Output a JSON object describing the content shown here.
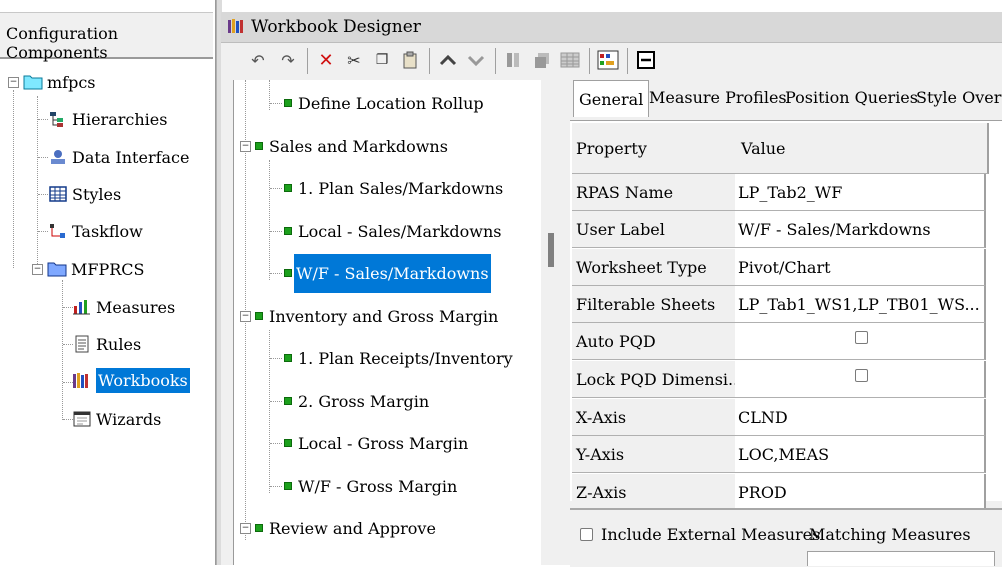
{
  "left_panel": {
    "header": "Configuration Components",
    "tree": {
      "root": "mfpcs",
      "items": [
        "Hierarchies",
        "Data Interface",
        "Styles",
        "Taskflow"
      ],
      "group": "MFPRCS",
      "group_items": [
        "Measures",
        "Rules",
        "Workbooks",
        "Wizards"
      ],
      "selected": "Workbooks"
    }
  },
  "designer": {
    "title": "Workbook Designer",
    "toolbar": {
      "icons": [
        "undo-icon",
        "redo-icon",
        "delete-icon",
        "cut-icon",
        "copy-icon",
        "paste-icon",
        "move-up-icon",
        "move-down-icon",
        "tab-icon",
        "window-icon",
        "grid-icon",
        "chart-icon",
        "collapse-icon"
      ]
    }
  },
  "mid_tree": {
    "rows": [
      {
        "label": "Define Location Rollup",
        "level": 2
      },
      {
        "label": "Sales and Markdowns",
        "level": 1
      },
      {
        "label": "1. Plan Sales/Markdowns",
        "level": 2
      },
      {
        "label": "Local - Sales/Markdowns",
        "level": 2
      },
      {
        "label": "W/F - Sales/Markdowns",
        "level": 2,
        "selected": true
      },
      {
        "label": "Inventory and Gross Margin",
        "level": 1
      },
      {
        "label": "1. Plan Receipts/Inventory",
        "level": 2
      },
      {
        "label": "2. Gross Margin",
        "level": 2
      },
      {
        "label": "Local - Gross Margin",
        "level": 2
      },
      {
        "label": "W/F - Gross Margin",
        "level": 2
      },
      {
        "label": "Review and Approve",
        "level": 1
      }
    ]
  },
  "properties": {
    "tabs": [
      "General",
      "Measure Profiles",
      "Position Queries",
      "Style Overri"
    ],
    "active_tab": "General",
    "headers": {
      "property": "Property",
      "value": "Value"
    },
    "rows": [
      {
        "key": "RPAS Name",
        "value": "LP_Tab2_WF"
      },
      {
        "key": "User Label",
        "value": "W/F - Sales/Markdowns"
      },
      {
        "key": "Worksheet Type",
        "value": "Pivot/Chart"
      },
      {
        "key": "Filterable Sheets",
        "value": "LP_Tab1_WS1,LP_TB01_WS..."
      },
      {
        "key": "Auto PQD",
        "value": "",
        "checkbox": true,
        "checked": false
      },
      {
        "key": "Lock PQD Dimensi...",
        "value": "",
        "checkbox": true,
        "checked": false
      },
      {
        "key": "X-Axis",
        "value": "CLND"
      },
      {
        "key": "Y-Axis",
        "value": "LOC,MEAS"
      },
      {
        "key": "Z-Axis",
        "value": "PROD"
      }
    ],
    "include_external": {
      "label": "Include External Measures",
      "checked": false
    },
    "matching_label": "Matching Measures"
  }
}
